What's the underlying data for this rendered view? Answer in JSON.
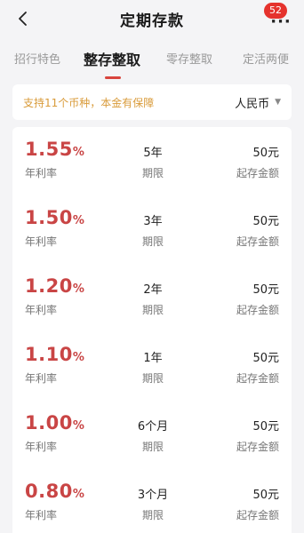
{
  "header": {
    "title": "定期存款",
    "more_dots": "···",
    "badge_count": "52"
  },
  "tabs": [
    {
      "label": "招行特色",
      "active": false
    },
    {
      "label": "整存整取",
      "active": true
    },
    {
      "label": "零存整取",
      "active": false
    },
    {
      "label": "定活两便",
      "active": false
    }
  ],
  "notice": {
    "text": "支持11个币种，本金有保障",
    "currency": "人民币"
  },
  "rows": [
    {
      "rate": "1.55",
      "pct": "%",
      "rate_label": "年利率",
      "term": "5年",
      "term_label": "期限",
      "min": "50元",
      "min_label": "起存金额"
    },
    {
      "rate": "1.50",
      "pct": "%",
      "rate_label": "年利率",
      "term": "3年",
      "term_label": "期限",
      "min": "50元",
      "min_label": "起存金额"
    },
    {
      "rate": "1.20",
      "pct": "%",
      "rate_label": "年利率",
      "term": "2年",
      "term_label": "期限",
      "min": "50元",
      "min_label": "起存金额"
    },
    {
      "rate": "1.10",
      "pct": "%",
      "rate_label": "年利率",
      "term": "1年",
      "term_label": "期限",
      "min": "50元",
      "min_label": "起存金额"
    },
    {
      "rate": "1.00",
      "pct": "%",
      "rate_label": "年利率",
      "term": "6个月",
      "term_label": "期限",
      "min": "50元",
      "min_label": "起存金额"
    },
    {
      "rate": "0.80",
      "pct": "%",
      "rate_label": "年利率",
      "term": "3个月",
      "term_label": "期限",
      "min": "50元",
      "min_label": "起存金额"
    }
  ],
  "colors": {
    "rate": "#c94545",
    "accent": "#d8443d",
    "notice_text": "#d99b3a",
    "badge": "#e5322d"
  },
  "icons": {
    "back": "chevron-left-icon",
    "more": "more-dots-icon",
    "dropdown": "caret-down-icon"
  }
}
